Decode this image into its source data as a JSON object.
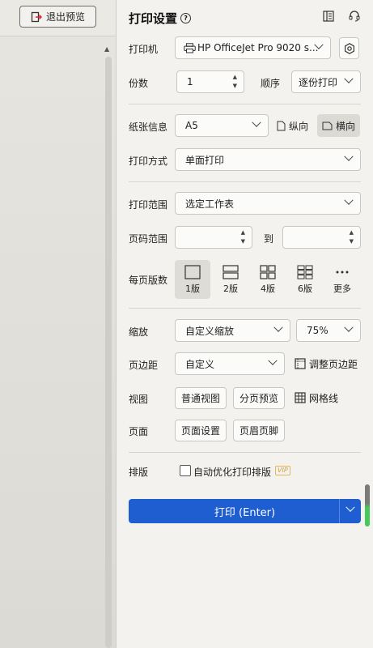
{
  "left": {
    "exit_preview_label": "退出预览"
  },
  "panel": {
    "title": "打印设置",
    "printer": {
      "label": "打印机",
      "value": "HP OfficeJet Pro 9020 s..."
    },
    "copies": {
      "label": "份数",
      "value": "1"
    },
    "order": {
      "label": "顺序",
      "value": "逐份打印"
    },
    "paper": {
      "label": "纸张信息",
      "value": "A5",
      "portrait_label": "纵向",
      "landscape_label": "横向"
    },
    "print_mode": {
      "label": "打印方式",
      "value": "单面打印"
    },
    "print_range": {
      "label": "打印范围",
      "value": "选定工作表"
    },
    "page_range": {
      "label": "页码范围",
      "from": "",
      "to_label": "到",
      "to": ""
    },
    "pages_per_sheet": {
      "label": "每页版数",
      "options": [
        "1版",
        "2版",
        "4版",
        "6版",
        "更多"
      ],
      "selected": "1版"
    },
    "scale": {
      "label": "缩放",
      "value": "自定义缩放",
      "percent": "75%"
    },
    "margins": {
      "label": "页边距",
      "value": "自定义",
      "adjust_label": "调整页边距"
    },
    "view": {
      "label": "视图",
      "normal_view": "普通视图",
      "page_break_preview": "分页预览",
      "gridlines": "网格线"
    },
    "page": {
      "label": "页面",
      "page_setup": "页面设置",
      "header_footer": "页眉页脚"
    },
    "layout": {
      "label": "排版",
      "auto_optimize": "自动优化打印排版",
      "vip_badge": "VIP"
    },
    "print_button": "打印 (Enter)"
  },
  "colors": {
    "accent": "#1e5ed1",
    "vip": "#d4a038"
  }
}
